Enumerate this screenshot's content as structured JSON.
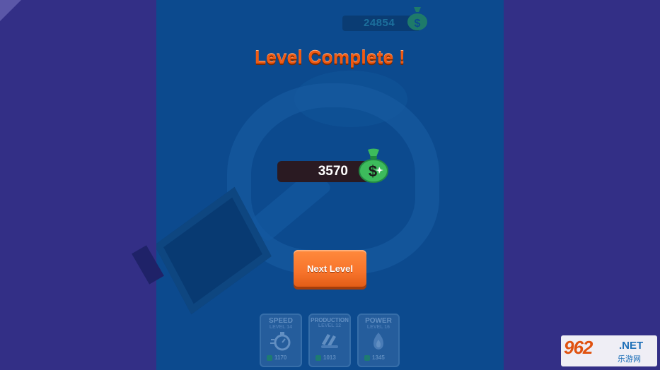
{
  "top_currency": {
    "amount": "24854",
    "icon": "money-bag-icon"
  },
  "title": "Level Complete !",
  "reward": {
    "amount": "3570",
    "icon": "money-bag-icon"
  },
  "next_button": {
    "label": "Next Level"
  },
  "upgrades": [
    {
      "title": "SPEED",
      "level": "LEVEL 14",
      "cost": "1170",
      "icon": "stopwatch-icon"
    },
    {
      "title": "PRODUCTION",
      "level": "LEVEL 12",
      "cost": "1013",
      "icon": "conveyor-icon"
    },
    {
      "title": "POWER",
      "level": "LEVEL 16",
      "cost": "1345",
      "icon": "flame-icon"
    }
  ],
  "watermark": {
    "brand": "962",
    "suffix": ".NET",
    "cn": "乐游网"
  },
  "colors": {
    "title": "#f05a13",
    "button": "#f7742b",
    "money_green": "#2ea35a",
    "stage": "#0c4a8e",
    "sides": "#332f86"
  }
}
